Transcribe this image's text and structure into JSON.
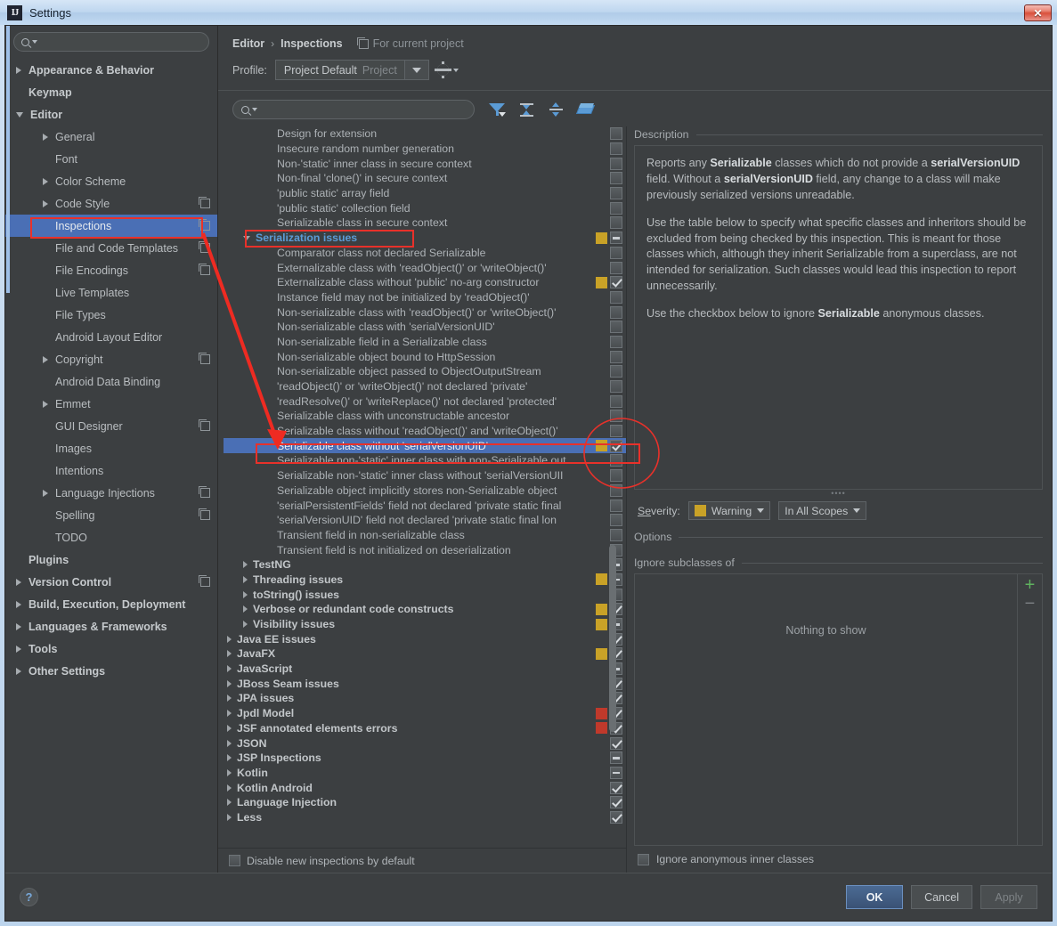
{
  "window": {
    "title": "Settings",
    "logo": "IJ",
    "close_label": "✕"
  },
  "sidebar": {
    "search_placeholder": "",
    "items": [
      {
        "label": "Appearance & Behavior",
        "level": 0,
        "arrow": "right",
        "copy": false,
        "selected": false
      },
      {
        "label": "Keymap",
        "level": 0,
        "arrow": "none",
        "copy": false,
        "selected": false
      },
      {
        "label": "Editor",
        "level": 0,
        "arrow": "down",
        "copy": false,
        "selected": false
      },
      {
        "label": "General",
        "level": 1,
        "arrow": "right",
        "copy": false,
        "selected": false
      },
      {
        "label": "Font",
        "level": 1,
        "arrow": "none",
        "copy": false,
        "selected": false
      },
      {
        "label": "Color Scheme",
        "level": 1,
        "arrow": "right",
        "copy": false,
        "selected": false
      },
      {
        "label": "Code Style",
        "level": 1,
        "arrow": "right",
        "copy": true,
        "selected": false
      },
      {
        "label": "Inspections",
        "level": 1,
        "arrow": "none",
        "copy": true,
        "selected": true
      },
      {
        "label": "File and Code Templates",
        "level": 1,
        "arrow": "none",
        "copy": true,
        "selected": false
      },
      {
        "label": "File Encodings",
        "level": 1,
        "arrow": "none",
        "copy": true,
        "selected": false
      },
      {
        "label": "Live Templates",
        "level": 1,
        "arrow": "none",
        "copy": false,
        "selected": false
      },
      {
        "label": "File Types",
        "level": 1,
        "arrow": "none",
        "copy": false,
        "selected": false
      },
      {
        "label": "Android Layout Editor",
        "level": 1,
        "arrow": "none",
        "copy": false,
        "selected": false
      },
      {
        "label": "Copyright",
        "level": 1,
        "arrow": "right",
        "copy": true,
        "selected": false
      },
      {
        "label": "Android Data Binding",
        "level": 1,
        "arrow": "none",
        "copy": false,
        "selected": false
      },
      {
        "label": "Emmet",
        "level": 1,
        "arrow": "right",
        "copy": false,
        "selected": false
      },
      {
        "label": "GUI Designer",
        "level": 1,
        "arrow": "none",
        "copy": true,
        "selected": false
      },
      {
        "label": "Images",
        "level": 1,
        "arrow": "none",
        "copy": false,
        "selected": false
      },
      {
        "label": "Intentions",
        "level": 1,
        "arrow": "none",
        "copy": false,
        "selected": false
      },
      {
        "label": "Language Injections",
        "level": 1,
        "arrow": "right",
        "copy": true,
        "selected": false
      },
      {
        "label": "Spelling",
        "level": 1,
        "arrow": "none",
        "copy": true,
        "selected": false
      },
      {
        "label": "TODO",
        "level": 1,
        "arrow": "none",
        "copy": false,
        "selected": false
      },
      {
        "label": "Plugins",
        "level": 0,
        "arrow": "none",
        "copy": false,
        "selected": false
      },
      {
        "label": "Version Control",
        "level": 0,
        "arrow": "right",
        "copy": true,
        "selected": false
      },
      {
        "label": "Build, Execution, Deployment",
        "level": 0,
        "arrow": "right",
        "copy": false,
        "selected": false
      },
      {
        "label": "Languages & Frameworks",
        "level": 0,
        "arrow": "right",
        "copy": false,
        "selected": false
      },
      {
        "label": "Tools",
        "level": 0,
        "arrow": "right",
        "copy": false,
        "selected": false
      },
      {
        "label": "Other Settings",
        "level": 0,
        "arrow": "right",
        "copy": false,
        "selected": false
      }
    ]
  },
  "header": {
    "breadcrumb_root": "Editor",
    "breadcrumb_sep": "›",
    "breadcrumb_current": "Inspections",
    "scope_note": "For current project",
    "profile_label": "Profile:",
    "profile_value": "Project Default",
    "profile_kind": "Project",
    "search_placeholder": ""
  },
  "toolbar": {
    "filter_icon": "filter-funnel-icon",
    "expand_icon": "expand-all-icon",
    "collapse_icon": "collapse-all-icon",
    "reset_icon": "reset-eraser-icon",
    "gear_icon": "gear-icon"
  },
  "inspections": {
    "footer_checkbox_label": "Disable new inspections by default",
    "footer_checkbox_checked": false,
    "rows": [
      {
        "label": "Design for extension",
        "indent": "leaf",
        "arrow": "none",
        "group": false,
        "severity": "none",
        "check": "empty",
        "selected": false
      },
      {
        "label": "Insecure random number generation",
        "indent": "leaf",
        "arrow": "none",
        "group": false,
        "severity": "none",
        "check": "empty",
        "selected": false
      },
      {
        "label": "Non-'static' inner class in secure context",
        "indent": "leaf",
        "arrow": "none",
        "group": false,
        "severity": "none",
        "check": "empty",
        "selected": false
      },
      {
        "label": "Non-final 'clone()' in secure context",
        "indent": "leaf",
        "arrow": "none",
        "group": false,
        "severity": "none",
        "check": "empty",
        "selected": false
      },
      {
        "label": "'public static' array field",
        "indent": "leaf",
        "arrow": "none",
        "group": false,
        "severity": "none",
        "check": "empty",
        "selected": false
      },
      {
        "label": "'public static' collection field",
        "indent": "leaf",
        "arrow": "none",
        "group": false,
        "severity": "none",
        "check": "empty",
        "selected": false
      },
      {
        "label": "Serializable class in secure context",
        "indent": "leaf",
        "arrow": "none",
        "group": false,
        "severity": "none",
        "check": "empty",
        "selected": false
      },
      {
        "label": "Serialization issues",
        "indent": "l2",
        "arrow": "down",
        "group": true,
        "blue": true,
        "severity": "warn",
        "check": "dash",
        "selected": false
      },
      {
        "label": "Comparator class not declared Serializable",
        "indent": "leaf",
        "arrow": "none",
        "group": false,
        "severity": "none",
        "check": "empty",
        "selected": false
      },
      {
        "label": "Externalizable class with 'readObject()' or 'writeObject()'",
        "indent": "leaf",
        "arrow": "none",
        "group": false,
        "severity": "none",
        "check": "empty",
        "selected": false
      },
      {
        "label": "Externalizable class without 'public' no-arg constructor",
        "indent": "leaf",
        "arrow": "none",
        "group": false,
        "severity": "warn",
        "check": "checked",
        "selected": false
      },
      {
        "label": "Instance field may not be initialized by 'readObject()'",
        "indent": "leaf",
        "arrow": "none",
        "group": false,
        "severity": "none",
        "check": "empty",
        "selected": false
      },
      {
        "label": "Non-serializable class with 'readObject()' or 'writeObject()'",
        "indent": "leaf",
        "arrow": "none",
        "group": false,
        "severity": "none",
        "check": "empty",
        "selected": false
      },
      {
        "label": "Non-serializable class with 'serialVersionUID'",
        "indent": "leaf",
        "arrow": "none",
        "group": false,
        "severity": "none",
        "check": "empty",
        "selected": false
      },
      {
        "label": "Non-serializable field in a Serializable class",
        "indent": "leaf",
        "arrow": "none",
        "group": false,
        "severity": "none",
        "check": "empty",
        "selected": false
      },
      {
        "label": "Non-serializable object bound to HttpSession",
        "indent": "leaf",
        "arrow": "none",
        "group": false,
        "severity": "none",
        "check": "empty",
        "selected": false
      },
      {
        "label": "Non-serializable object passed to ObjectOutputStream",
        "indent": "leaf",
        "arrow": "none",
        "group": false,
        "severity": "none",
        "check": "empty",
        "selected": false
      },
      {
        "label": "'readObject()' or 'writeObject()' not declared 'private'",
        "indent": "leaf",
        "arrow": "none",
        "group": false,
        "severity": "none",
        "check": "empty",
        "selected": false
      },
      {
        "label": "'readResolve()' or 'writeReplace()' not declared 'protected'",
        "indent": "leaf",
        "arrow": "none",
        "group": false,
        "severity": "none",
        "check": "empty",
        "selected": false
      },
      {
        "label": "Serializable class with unconstructable ancestor",
        "indent": "leaf",
        "arrow": "none",
        "group": false,
        "severity": "none",
        "check": "empty",
        "selected": false
      },
      {
        "label": "Serializable class without 'readObject()' and 'writeObject()'",
        "indent": "leaf",
        "arrow": "none",
        "group": false,
        "severity": "none",
        "check": "empty",
        "selected": false
      },
      {
        "label": "Serializable class without 'serialVersionUID'",
        "indent": "leaf",
        "arrow": "none",
        "group": false,
        "severity": "warn",
        "check": "checked",
        "selected": true
      },
      {
        "label": "Serializable non-'static' inner class with non-Serializable out",
        "indent": "leaf",
        "arrow": "none",
        "group": false,
        "severity": "none",
        "check": "empty",
        "selected": false
      },
      {
        "label": "Serializable non-'static' inner class without 'serialVersionUII",
        "indent": "leaf",
        "arrow": "none",
        "group": false,
        "severity": "none",
        "check": "empty",
        "selected": false
      },
      {
        "label": "Serializable object implicitly stores non-Serializable object",
        "indent": "leaf",
        "arrow": "none",
        "group": false,
        "severity": "none",
        "check": "empty",
        "selected": false
      },
      {
        "label": "'serialPersistentFields' field not declared 'private static final",
        "indent": "leaf",
        "arrow": "none",
        "group": false,
        "severity": "none",
        "check": "empty",
        "selected": false
      },
      {
        "label": "'serialVersionUID' field not declared 'private static final lon",
        "indent": "leaf",
        "arrow": "none",
        "group": false,
        "severity": "none",
        "check": "empty",
        "selected": false
      },
      {
        "label": "Transient field in non-serializable class",
        "indent": "leaf",
        "arrow": "none",
        "group": false,
        "severity": "none",
        "check": "empty",
        "selected": false
      },
      {
        "label": "Transient field is not initialized on deserialization",
        "indent": "leaf",
        "arrow": "none",
        "group": false,
        "severity": "none",
        "check": "empty",
        "selected": false
      },
      {
        "label": "TestNG",
        "indent": "l2",
        "arrow": "right",
        "group": true,
        "severity": "none",
        "check": "dash",
        "selected": false
      },
      {
        "label": "Threading issues",
        "indent": "l2",
        "arrow": "right",
        "group": true,
        "severity": "warn",
        "check": "dash",
        "selected": false
      },
      {
        "label": "toString() issues",
        "indent": "l2",
        "arrow": "right",
        "group": true,
        "severity": "none",
        "check": "empty",
        "selected": false
      },
      {
        "label": "Verbose or redundant code constructs",
        "indent": "l2",
        "arrow": "right",
        "group": true,
        "severity": "warn",
        "check": "checked",
        "selected": false
      },
      {
        "label": "Visibility issues",
        "indent": "l2",
        "arrow": "right",
        "group": true,
        "severity": "warn",
        "check": "dash",
        "selected": false
      },
      {
        "label": "Java EE issues",
        "indent": "l1",
        "arrow": "right",
        "group": true,
        "severity": "none",
        "check": "checked",
        "selected": false
      },
      {
        "label": "JavaFX",
        "indent": "l1",
        "arrow": "right",
        "group": true,
        "severity": "warn",
        "check": "checked",
        "selected": false
      },
      {
        "label": "JavaScript",
        "indent": "l1",
        "arrow": "right",
        "group": true,
        "severity": "none",
        "check": "dash",
        "selected": false
      },
      {
        "label": "JBoss Seam issues",
        "indent": "l1",
        "arrow": "right",
        "group": true,
        "severity": "none",
        "check": "checked",
        "selected": false
      },
      {
        "label": "JPA issues",
        "indent": "l1",
        "arrow": "right",
        "group": true,
        "severity": "none",
        "check": "checked",
        "selected": false
      },
      {
        "label": "Jpdl Model",
        "indent": "l1",
        "arrow": "right",
        "group": true,
        "severity": "err",
        "check": "checked",
        "selected": false
      },
      {
        "label": "JSF annotated elements errors",
        "indent": "l1",
        "arrow": "right",
        "group": true,
        "severity": "err",
        "check": "checked",
        "selected": false
      },
      {
        "label": "JSON",
        "indent": "l1",
        "arrow": "right",
        "group": true,
        "severity": "none",
        "check": "checked",
        "selected": false
      },
      {
        "label": "JSP Inspections",
        "indent": "l1",
        "arrow": "right",
        "group": true,
        "severity": "none",
        "check": "dash",
        "selected": false
      },
      {
        "label": "Kotlin",
        "indent": "l1",
        "arrow": "right",
        "group": true,
        "severity": "none",
        "check": "dash",
        "selected": false
      },
      {
        "label": "Kotlin Android",
        "indent": "l1",
        "arrow": "right",
        "group": true,
        "severity": "none",
        "check": "checked",
        "selected": false
      },
      {
        "label": "Language Injection",
        "indent": "l1",
        "arrow": "right",
        "group": true,
        "severity": "none",
        "check": "checked",
        "selected": false
      },
      {
        "label": "Less",
        "indent": "l1",
        "arrow": "right",
        "group": true,
        "severity": "none",
        "check": "checked",
        "selected": false
      }
    ]
  },
  "description": {
    "section_label": "Description",
    "paragraphs": [
      [
        {
          "t": "Reports any ",
          "b": false
        },
        {
          "t": "Serializable",
          "b": true
        },
        {
          "t": " classes which do not provide a ",
          "b": false
        },
        {
          "t": "serialVersionUID",
          "b": true
        },
        {
          "t": " field. Without a ",
          "b": false
        },
        {
          "t": "serialVersionUID",
          "b": true
        },
        {
          "t": " field, any change to a class will make previously serialized versions unreadable.",
          "b": false
        }
      ],
      [
        {
          "t": "Use the table below to specify what specific classes and inheritors should be excluded from being checked by this inspection. This is meant for those classes which, although they inherit Serializable from a superclass, are not intended for serialization. Such classes would lead this inspection to report unnecessarily.",
          "b": false
        }
      ],
      [
        {
          "t": "Use the checkbox below to ignore ",
          "b": false
        },
        {
          "t": "Serializable",
          "b": true
        },
        {
          "t": " anonymous classes.",
          "b": false
        }
      ]
    ]
  },
  "severity": {
    "label": "Severity:",
    "value": "Warning",
    "color": "#c9a227",
    "scope_value": "In All Scopes"
  },
  "options": {
    "section_label": "Options",
    "subsection_label": "Ignore subclasses of",
    "empty_text": "Nothing to show",
    "add_icon": "plus-icon",
    "remove_icon": "minus-icon",
    "checkbox_label": "Ignore anonymous inner classes",
    "checkbox_checked": false
  },
  "footer": {
    "help_label": "?",
    "ok_label": "OK",
    "cancel_label": "Cancel",
    "apply_label": "Apply"
  }
}
